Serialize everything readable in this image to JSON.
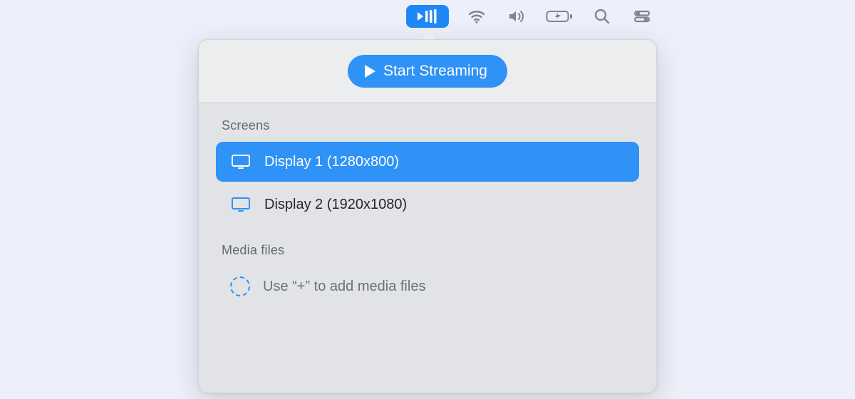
{
  "menubar": {
    "icons": [
      "stream-icon",
      "wifi-icon",
      "volume-icon",
      "battery-icon",
      "search-icon",
      "control-center-icon"
    ],
    "active": "stream-icon"
  },
  "panel": {
    "start_label": "Start Streaming",
    "screens": {
      "title": "Screens",
      "items": [
        {
          "label": "Display 1 (1280x800)",
          "selected": true
        },
        {
          "label": "Display 2 (1920x1080)",
          "selected": false
        }
      ]
    },
    "media": {
      "title": "Media files",
      "empty_hint": "Use “+” to add media files"
    }
  },
  "colors": {
    "accent": "#2f92f6",
    "panel_bg": "#e1e3e6",
    "panel_top_bg": "#ebedef",
    "page_bg": "#edeffa",
    "muted_text": "#6d7177"
  }
}
